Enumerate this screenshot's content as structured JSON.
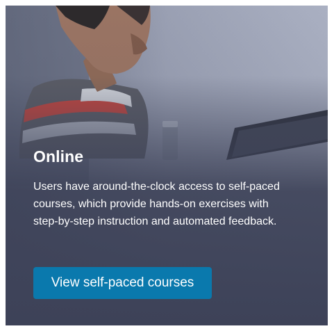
{
  "card": {
    "title": "Online",
    "description": "Users have around-the-clock access to self-paced courses, which provide hands-on exercises with step-by-step instruction and automated feedback.",
    "button_label": "View self-paced courses",
    "colors": {
      "overlay": "#3d4258",
      "button": "#0a79ad",
      "text": "#ffffff"
    }
  }
}
